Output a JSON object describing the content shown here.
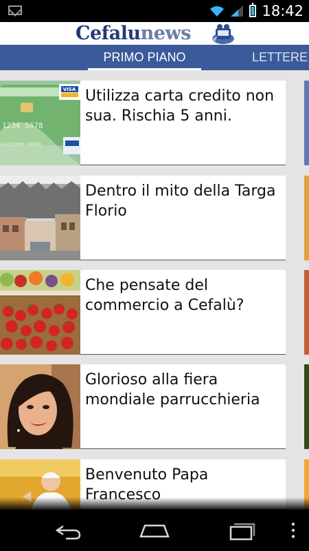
{
  "status": {
    "time": "18:42",
    "icons": [
      "gmail-icon",
      "wifi-icon",
      "signal-icon",
      "battery-icon"
    ]
  },
  "app": {
    "logo_main": "Cefalu",
    "logo_accent": "news"
  },
  "tabs": [
    {
      "label": "PRIMO PIANO",
      "active": true
    },
    {
      "label": "LETTERE",
      "active": false
    }
  ],
  "articles": [
    {
      "title": "Utilizza carta credito non sua. Rischia 5 anni.",
      "thumb": "credit-card"
    },
    {
      "title": "Dentro il mito della Targa Florio",
      "thumb": "street-scene"
    },
    {
      "title": "Che pensate del commercio a Cefalù?",
      "thumb": "fruit-market"
    },
    {
      "title": "Glorioso alla fiera mondiale parrucchieria",
      "thumb": "woman-portrait"
    },
    {
      "title": "Benvenuto Papa Francesco",
      "thumb": "pope"
    }
  ],
  "colors": {
    "tab_bar": "#3b5a9a",
    "logo": "#243a78",
    "status_accent": "#39b4ff"
  },
  "thumb_text": {
    "card_number": "1234 5678",
    "card_name": "GIUSEPPE VERDI",
    "card_brand": "VISA"
  },
  "navigation": [
    "back-icon",
    "home-icon",
    "recent-apps-icon",
    "menu-icon"
  ]
}
